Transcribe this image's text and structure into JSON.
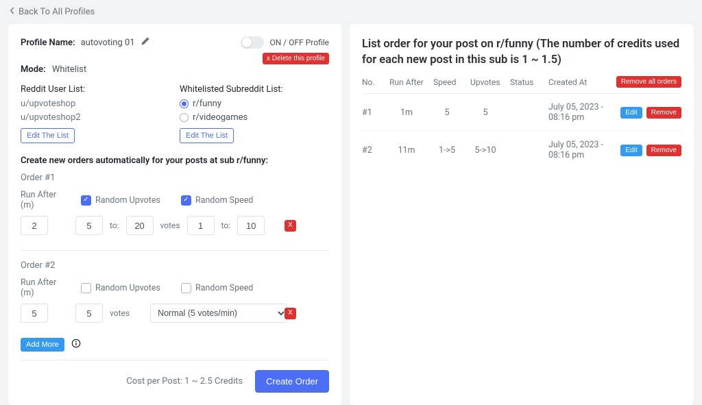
{
  "back_link": "Back To All Profiles",
  "profile": {
    "name_label": "Profile Name:",
    "name_value": "autovoting 01",
    "onoff_label": "ON / OFF Profile",
    "delete_label": "x Delete this profile",
    "mode_label": "Mode:",
    "mode_value": "Whitelist"
  },
  "user_list": {
    "title": "Reddit User List:",
    "items": [
      "u/upvoteshop",
      "u/upvoteshop2"
    ],
    "edit_label": "Edit The List"
  },
  "sub_list": {
    "title": "Whitelisted Subreddit List:",
    "items": [
      "r/funny",
      "r/videogames"
    ],
    "edit_label": "Edit The List"
  },
  "create_section": {
    "title": "Create new orders automatically for your posts at sub r/funny:",
    "run_after_label": "Run After (m)",
    "random_upvotes_label": "Random Upvotes",
    "random_speed_label": "Random Speed",
    "votes_label": "votes",
    "to_label": "to:",
    "speed_select_value": "Normal (5 votes/min)",
    "add_more_label": "Add More",
    "order1": {
      "label": "Order #1",
      "run_after": "2",
      "upvotes_from": "5",
      "upvotes_to": "20",
      "speed_from": "1",
      "speed_to": "10",
      "random_upvotes": true,
      "random_speed": true
    },
    "order2": {
      "label": "Order #2",
      "run_after": "5",
      "upvotes": "5",
      "random_upvotes": false,
      "random_speed": false
    }
  },
  "footer": {
    "cost_text": "Cost per Post: 1 ~ 2.5 Credits",
    "create_label": "Create Order"
  },
  "right_panel": {
    "title": "List order for your post on r/funny (The number of credits used for each new post in this sub is 1 ~ 1.5)",
    "headers": {
      "no": "No.",
      "run_after": "Run After",
      "speed": "Speed",
      "upvotes": "Upvotes",
      "status": "Status",
      "created": "Created At",
      "remove_all": "Remove all orders"
    },
    "edit_label": "Edit",
    "remove_label": "Remove",
    "rows": [
      {
        "no": "#1",
        "run_after": "1m",
        "speed": "5",
        "upvotes": "5",
        "created": "July 05, 2023 - 08:16 pm"
      },
      {
        "no": "#2",
        "run_after": "11m",
        "speed": "1->5",
        "upvotes": "5->10",
        "created": "July 05, 2023 - 08:16 pm"
      }
    ]
  }
}
